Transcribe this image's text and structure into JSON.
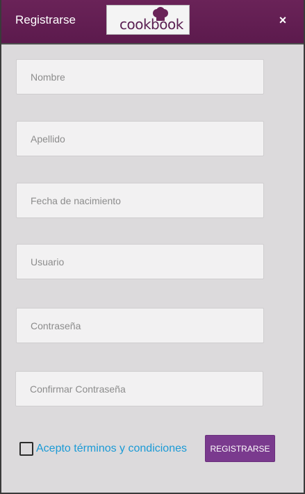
{
  "header": {
    "title": "Registrarse",
    "logo_text": "cookbook",
    "close_label": "×",
    "colors": {
      "bar": "#5c1a4d",
      "logo_text": "#5a1f52"
    }
  },
  "form": {
    "fields": [
      {
        "placeholder": "Nombre",
        "value": ""
      },
      {
        "placeholder": "Apellido",
        "value": ""
      },
      {
        "placeholder": "Fecha de nacimiento",
        "value": ""
      },
      {
        "placeholder": "Usuario",
        "value": ""
      },
      {
        "placeholder": "Contraseña",
        "value": ""
      },
      {
        "placeholder": "Confirmar Contraseña",
        "value": ""
      }
    ],
    "terms": {
      "label": "Acepto términos y condiciones",
      "checked": false,
      "color": "#1a9ad6"
    },
    "submit_label": "REGISTRARSE",
    "submit_color": "#7a3a8e"
  }
}
